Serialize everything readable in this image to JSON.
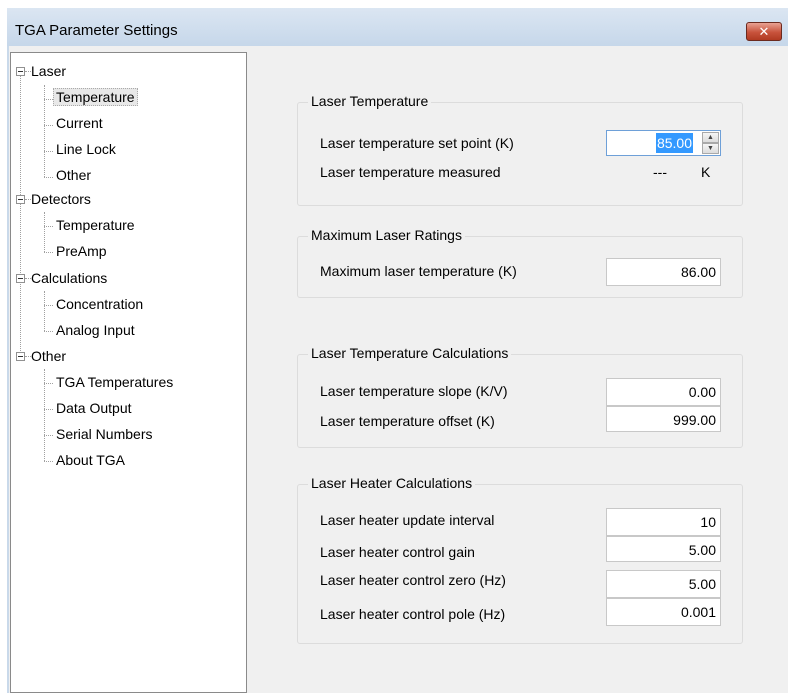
{
  "window": {
    "title": "TGA Parameter Settings",
    "close_glyph": "✕"
  },
  "tree": {
    "groups": [
      {
        "label": "Laser",
        "children": [
          "Temperature",
          "Current",
          "Line Lock",
          "Other"
        ]
      },
      {
        "label": "Detectors",
        "children": [
          "Temperature",
          "PreAmp"
        ]
      },
      {
        "label": "Calculations",
        "children": [
          "Concentration",
          "Analog Input"
        ]
      },
      {
        "label": "Other",
        "children": [
          "TGA Temperatures",
          "Data Output",
          "Serial Numbers",
          "About TGA"
        ]
      }
    ],
    "selected": "Laser > Temperature"
  },
  "laser_temperature": {
    "title": "Laser Temperature",
    "set_point_label": "Laser temperature set point (K)",
    "set_point_value": "85.00",
    "measured_label": "Laser temperature measured",
    "measured_value": "---",
    "measured_unit": "K"
  },
  "max_ratings": {
    "title": "Maximum Laser Ratings",
    "max_temp_label": "Maximum laser temperature (K)",
    "max_temp_value": "86.00"
  },
  "temp_calcs": {
    "title": "Laser Temperature Calculations",
    "slope_label": "Laser temperature slope (K/V)",
    "slope_value": "0.00",
    "offset_label": "Laser temperature offset (K)",
    "offset_value": "999.00"
  },
  "heater_calcs": {
    "title": "Laser Heater Calculations",
    "interval_label": "Laser heater update interval",
    "interval_value": "10",
    "gain_label": "Laser heater control gain",
    "gain_value": "5.00",
    "zero_label": "Laser heater control zero (Hz)",
    "zero_value": "5.00",
    "pole_label": "Laser heater control pole (Hz)",
    "pole_value": "0.001"
  },
  "colors": {
    "selection": "#3399ff",
    "close_button": "#c8533c",
    "titlebar": "#c6d7ea"
  }
}
